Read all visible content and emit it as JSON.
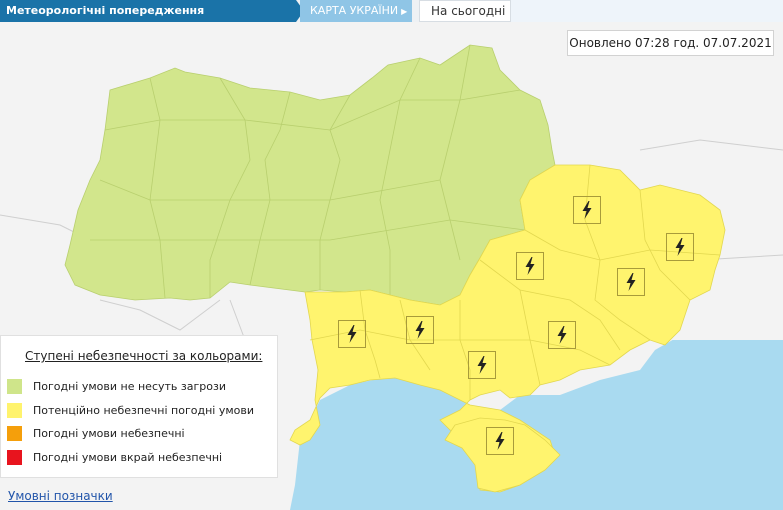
{
  "header": {
    "title": "Метеорологічні попередження",
    "map_tab": "КАРТА УКРАЇНИ",
    "today_tab": "На сьогодні"
  },
  "updated": "Оновлено 07:28 год. 07.07.2021",
  "legend": {
    "title": "Ступені небезпечності за кольорами:",
    "items": [
      {
        "label": "Погодні умови не несуть загрози",
        "color": "#cfe58a"
      },
      {
        "label": "Потенційно небезпечні погодні умови",
        "color": "#fff36d"
      },
      {
        "label": "Погодні умови небезпечні",
        "color": "#f59f0b"
      },
      {
        "label": "Погодні умови вкрай небезпечні",
        "color": "#e8141e"
      }
    ]
  },
  "footer_link": "Умовні позначки",
  "map": {
    "no_threat_color": "#d2e68c",
    "warning_color": "#fff46e",
    "sea_color": "#a9daf0",
    "warning_icon": "lightning-icon",
    "warning_icon_count": 9
  }
}
